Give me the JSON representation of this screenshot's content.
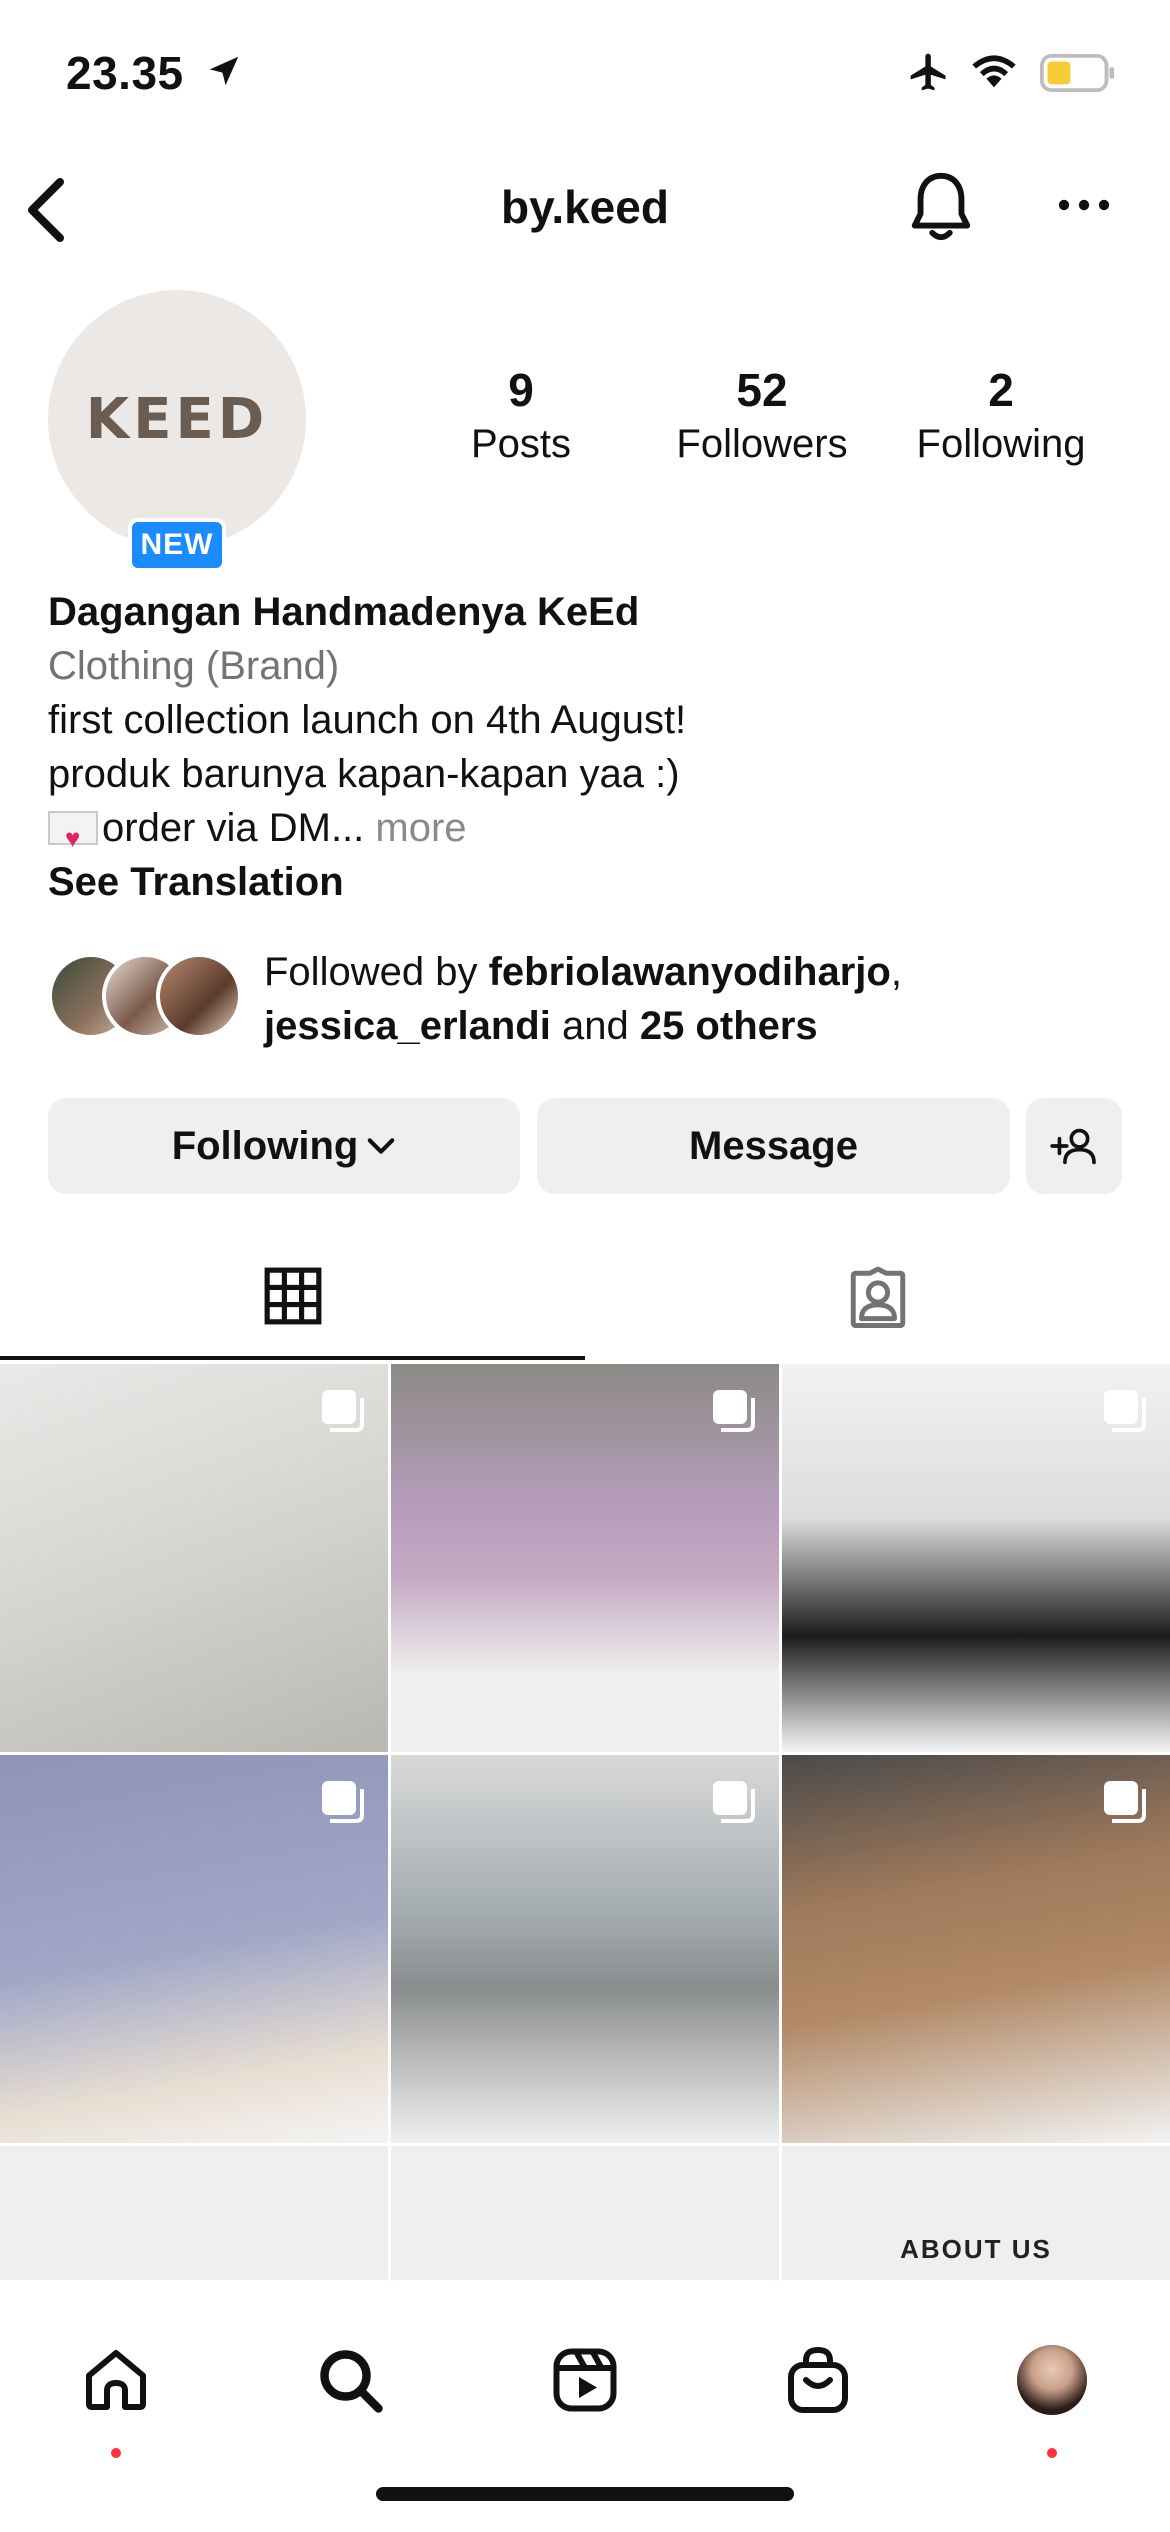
{
  "status": {
    "time": "23.35"
  },
  "header": {
    "title": "by.keed"
  },
  "profile": {
    "avatar_text": "KEED",
    "new_badge": "NEW",
    "stats": [
      {
        "value": "9",
        "label": "Posts"
      },
      {
        "value": "52",
        "label": "Followers"
      },
      {
        "value": "2",
        "label": "Following"
      }
    ],
    "name": "Dagangan Handmadenya KeEd",
    "category": "Clothing (Brand)",
    "bio_lines": [
      "first collection launch on 4th August!",
      "produk barunya kapan-kapan yaa :)",
      "order via DM..."
    ],
    "more": "more",
    "see_translation": "See Translation",
    "followed_by": {
      "prefix": "Followed by ",
      "user1": "febriolawanyodiharjo",
      "sep": ",",
      "user2": "jessica_erlandi",
      "and": " and ",
      "others": "25 others"
    }
  },
  "actions": {
    "following": "Following",
    "message": "Message"
  },
  "grid": {
    "about_us": "ABOUT US"
  }
}
